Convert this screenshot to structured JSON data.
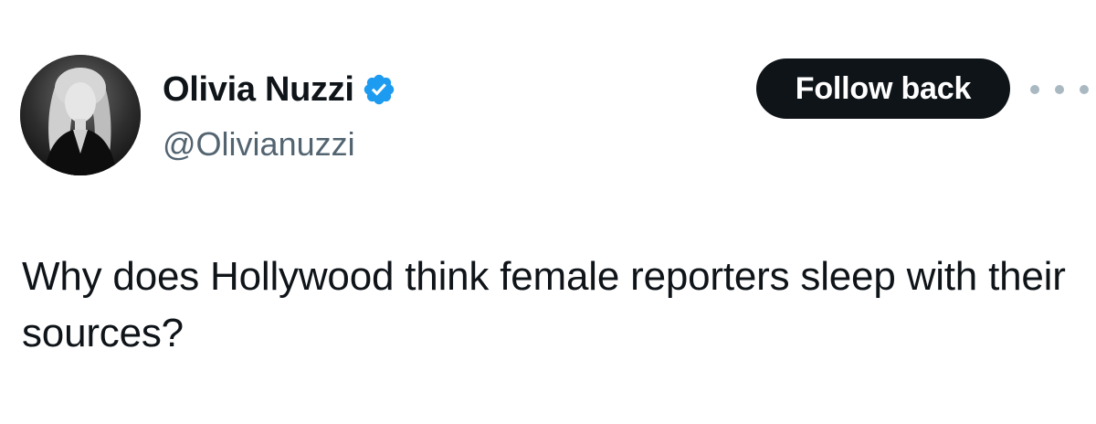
{
  "author": {
    "display_name": "Olivia Nuzzi",
    "handle": "@Olivianuzzi",
    "verified": true,
    "avatar_icon": "avatar-photo",
    "verified_icon": "verified-badge-icon"
  },
  "actions": {
    "follow_label": "Follow back",
    "more_icon": "more-options-icon"
  },
  "tweet": {
    "text": "Why does Hollywood think female reporters sleep with their sources?"
  },
  "colors": {
    "text_primary": "#0f1419",
    "text_secondary": "#536471",
    "verified_blue": "#1d9bf0",
    "button_bg": "#0f1419",
    "button_text": "#ffffff",
    "more_dots": "#aab8c2",
    "background": "#ffffff"
  }
}
